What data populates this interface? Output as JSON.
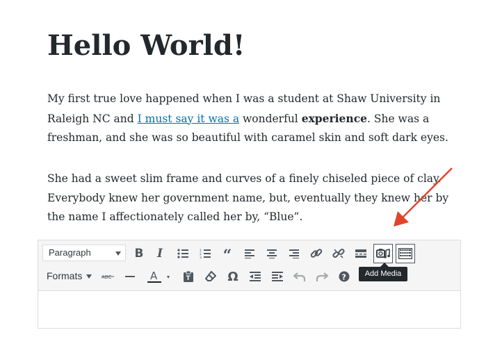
{
  "post": {
    "title": "Hello World!",
    "p1_a": "My first true love happened when I was a student at Shaw University in Raleigh NC and ",
    "p1_link": "I must say it was a",
    "p1_b": " wonderful ",
    "p1_bold": "experience",
    "p1_c": ". She was a freshman, and she was so beautiful with caramel skin and soft dark eyes.",
    "p2": "She had a sweet slim frame and curves of a finely chiseled piece of clay. Everybody knew her government name, but, eventually they knew her by the name I affectionately called her by, “Blue”."
  },
  "toolbar": {
    "paragraph_select": "Paragraph",
    "formats_label": "Formats",
    "tooltip": "Add Media",
    "accent_color": "#0073aa",
    "arrow_color": "#e0452b",
    "icons_row1": [
      "bold-icon",
      "italic-icon",
      "bullet-list-icon",
      "numbered-list-icon",
      "blockquote-icon",
      "align-left-icon",
      "align-center-icon",
      "align-right-icon",
      "link-icon",
      "unlink-icon",
      "read-more-icon",
      "add-media-icon",
      "toolbar-toggle-icon"
    ],
    "icons_row2": [
      "strikethrough-icon",
      "horizontal-line-icon",
      "text-color-icon",
      "paste-text-icon",
      "clear-formatting-icon",
      "special-character-icon",
      "outdent-icon",
      "indent-icon",
      "undo-icon",
      "redo-icon",
      "help-icon"
    ]
  }
}
